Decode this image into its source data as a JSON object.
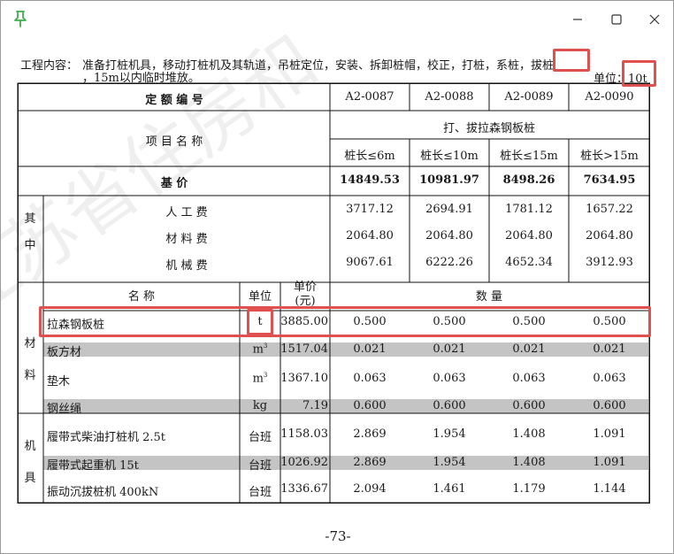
{
  "window": {
    "controls": [
      "minimize",
      "maximize",
      "close"
    ]
  },
  "doc": {
    "content_label": "工程内容：",
    "content_text": "准备打桩机具，移动打桩机及其轨道，吊桩定位，安装、拆卸桩帽，校正，打桩，系桩，",
    "content_highlight": "拔桩",
    "content_continuation": "，15m以内临时堆放。",
    "unit_label": "单位：",
    "unit_value": "10t",
    "watermark": "江苏省住房和",
    "page_number": "-73-"
  },
  "table": {
    "quota_no_label": "定 额 编 号",
    "item_name_label": "项 目 名 称",
    "codes": [
      "A2-0087",
      "A2-0088",
      "A2-0089",
      "A2-0090"
    ],
    "group_title": "打、拔拉森钢板桩",
    "sub_headers": [
      "桩长≤6m",
      "桩长≤10m",
      "桩长≤15m",
      "桩长>15m"
    ],
    "base_price_label": "基 价",
    "base_prices": [
      "14849.53",
      "10981.97",
      "8498.26",
      "7634.95"
    ],
    "among_label": [
      "其",
      "中"
    ],
    "cost_rows": [
      {
        "label": "人 工 费",
        "values": [
          "3717.12",
          "2694.91",
          "1781.12",
          "1657.22"
        ]
      },
      {
        "label": "材 料 费",
        "values": [
          "2064.80",
          "2064.80",
          "2064.80",
          "2064.80"
        ]
      },
      {
        "label": "机 械 费",
        "values": [
          "9067.61",
          "6222.26",
          "4652.34",
          "3912.93"
        ]
      }
    ],
    "col_name_label": "名 称",
    "col_unit_label": "单位",
    "col_price_label": [
      "单价",
      "(元)"
    ],
    "col_qty_label": "数 量",
    "materials_label": [
      "材",
      "料"
    ],
    "materials": [
      {
        "name": "拉森钢板桩",
        "unit": "t",
        "price": "3885.00",
        "values": [
          "0.500",
          "0.500",
          "0.500",
          "0.500"
        ]
      },
      {
        "name": "板方材",
        "unit": "m",
        "unit_sup": "3",
        "price": "1517.04",
        "values": [
          "0.021",
          "0.021",
          "0.021",
          "0.021"
        ]
      },
      {
        "name": "垫木",
        "unit": "m",
        "unit_sup": "3",
        "price": "1367.10",
        "values": [
          "0.063",
          "0.063",
          "0.063",
          "0.063"
        ]
      },
      {
        "name": "钢丝绳",
        "unit": "kg",
        "price": "7.19",
        "values": [
          "0.600",
          "0.600",
          "0.600",
          "0.600"
        ]
      }
    ],
    "machines_label": [
      "机",
      "具"
    ],
    "machines": [
      {
        "name": "履带式柴油打桩机 2.5t",
        "unit": "台班",
        "price": "1158.03",
        "values": [
          "2.869",
          "1.954",
          "1.408",
          "1.091"
        ]
      },
      {
        "name": "履带式起重机 15t",
        "unit": "台班",
        "price": "1026.92",
        "values": [
          "2.869",
          "1.954",
          "1.408",
          "1.091"
        ]
      },
      {
        "name": "振动沉拔桩机 400kN",
        "unit": "台班",
        "price": "1336.67",
        "values": [
          "2.094",
          "1.461",
          "1.179",
          "1.144"
        ]
      }
    ]
  },
  "colors": {
    "highlight": "#e0504f",
    "pin": "#3fae4b",
    "row_shade": "#c4c4c4"
  }
}
